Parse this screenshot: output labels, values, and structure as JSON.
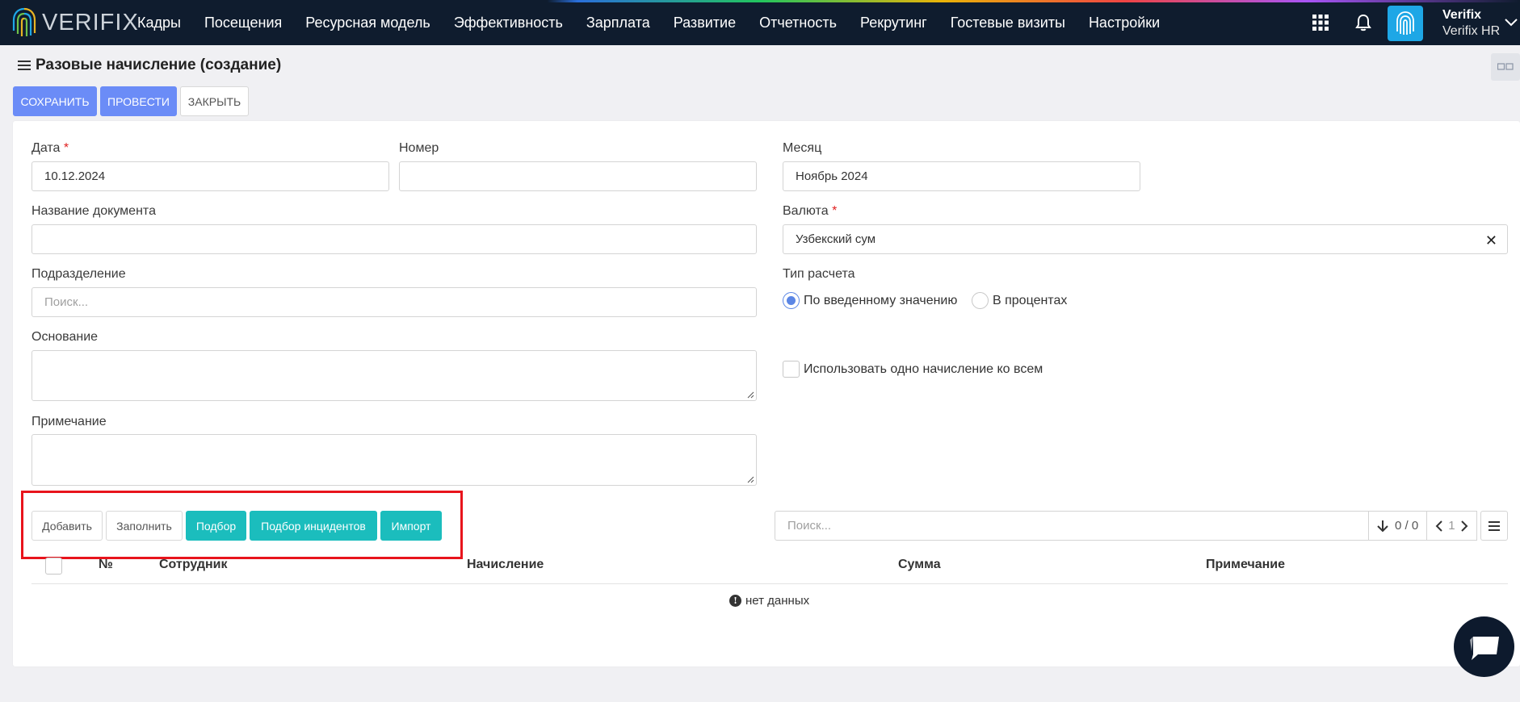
{
  "app": {
    "logo_text": "VERIFIX",
    "nav": [
      "Кадры",
      "Посещения",
      "Ресурсная модель",
      "Эффективность",
      "Зарплата",
      "Развитие",
      "Отчетность",
      "Рекрутинг",
      "Гостевые визиты",
      "Настройки"
    ],
    "user": {
      "name": "Verifix",
      "org": "Verifix HR"
    },
    "icons": [
      "apps-grid-icon",
      "bell-icon",
      "fingerprint-avatar-icon",
      "chevron-down-icon"
    ]
  },
  "page": {
    "title": "Разовые начисление (создание)",
    "toolbar": {
      "save": "СОХРАНИТЬ",
      "post": "ПРОВЕСТИ",
      "close": "ЗАКРЫТЬ"
    }
  },
  "form": {
    "date": {
      "label": "Дата",
      "required": "*",
      "value": "10.12.2024"
    },
    "number": {
      "label": "Номер",
      "value": ""
    },
    "month": {
      "label": "Месяц",
      "value": "Ноябрь 2024"
    },
    "doc_name": {
      "label": "Название документа",
      "value": ""
    },
    "currency": {
      "label": "Валюта",
      "required": "*",
      "value": "Узбекский сум",
      "clear": "✕"
    },
    "division": {
      "label": "Подразделение",
      "placeholder": "Поиск..."
    },
    "calc_type": {
      "label": "Тип расчета",
      "options": [
        "По введенному значению",
        "В процентах"
      ],
      "selected": "По введенному значению"
    },
    "basis": {
      "label": "Основание",
      "value": ""
    },
    "one_accrual": {
      "label": "Использовать одно начисление ко всем",
      "checked": false
    },
    "note": {
      "label": "Примечание",
      "value": ""
    }
  },
  "grid": {
    "buttons": {
      "add": "Добавить",
      "fill": "Заполнить",
      "select": "Подбор",
      "select_incidents": "Подбор инцидентов",
      "import": "Импорт"
    },
    "search_placeholder": "Поиск...",
    "pager": {
      "count": "0 / 0",
      "page": "1"
    },
    "columns": [
      "№",
      "Сотрудник",
      "Начисление",
      "Сумма",
      "Примечание"
    ],
    "empty": "нет данных"
  },
  "colors": {
    "navbar": "#0f1c2e",
    "primary": "#6b8cf7",
    "teal": "#1bbdbd",
    "highlight": "#e8141c"
  }
}
